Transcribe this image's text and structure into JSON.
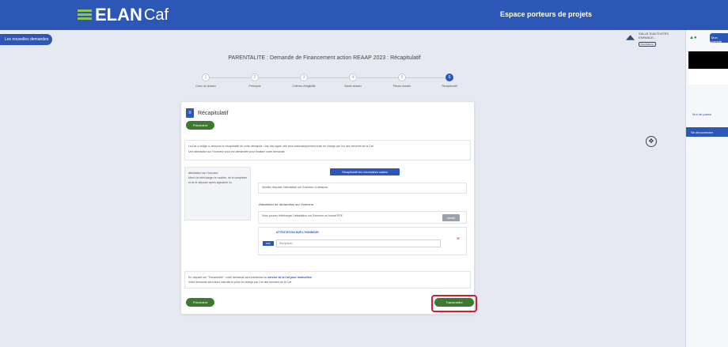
{
  "header": {
    "logo_main": "ELAN",
    "logo_sub": "Caf",
    "space_title": "Espace porteurs de projets"
  },
  "nav": {
    "back_label": "Les nouvelles demandes"
  },
  "user": {
    "name": "SALLE D'ACTIVITES ENFANCE...",
    "badge": "Associations"
  },
  "side": {
    "my_account": "Mon compte",
    "forgot": "Mot de passe",
    "disconnect": "Se déconnecter"
  },
  "page": {
    "title": "PARENTALITE : Demande de Financement action REAAP 2023 : Récapitulatif"
  },
  "steps": [
    {
      "num": "1",
      "label": "Choix du dossier"
    },
    {
      "num": "2",
      "label": "Prérequis"
    },
    {
      "num": "3",
      "label": "Critères d'éligibilité"
    },
    {
      "num": "4",
      "label": "Saisie dossier"
    },
    {
      "num": "5",
      "label": "Pièces dossier"
    },
    {
      "num": "6",
      "label": "Récapitulatif"
    }
  ],
  "card": {
    "title": "Récapitulatif",
    "prev_label": "Précédent",
    "info_line1": "La Caf a rédigé ci-dessous le récapitulatif de votre demande. Une fois signé, elle sera automatiquement prise en charge par l'un des services de la Caf.",
    "info_line2": "Une attestation sur l'honneur vous est demandée pour finaliser votre demande.",
    "note_title": "Attestation sur l'honneur",
    "note_body": "Merci de télécharger le modèle, de le compléter et de le déposer après signature ici.",
    "download_label": "Récapitulatif des informations saisies",
    "download_hint": "Veuillez déposer l'attestation sur l'honneur ci-dessous.",
    "section_label": "Attestation de déclaration sur l'honneur",
    "upload_hint": "Vous pouvez télécharger l'attestation sur l'honneur au format PDF.",
    "upload_btn": "Ajouter",
    "file_title": "ATTESTATION SUR L'HONNEUR",
    "file_tag": "PDF",
    "file_placeholder": "Remplacer",
    "delete_icon": "×",
    "footer_pre": "En cliquant sur \"Transmettre\", votre demande sera transmise au",
    "footer_hl": "service de la Caf pour instruction",
    "footer_line2": "Votre demande sera alors instruite et prise en charge par l'un des services de la Caf.",
    "prev_bottom": "Précédent",
    "submit_label": "Transmettre"
  },
  "icons": {
    "move": "move-icon",
    "doc": "document-icon",
    "trash": "delete-icon"
  }
}
